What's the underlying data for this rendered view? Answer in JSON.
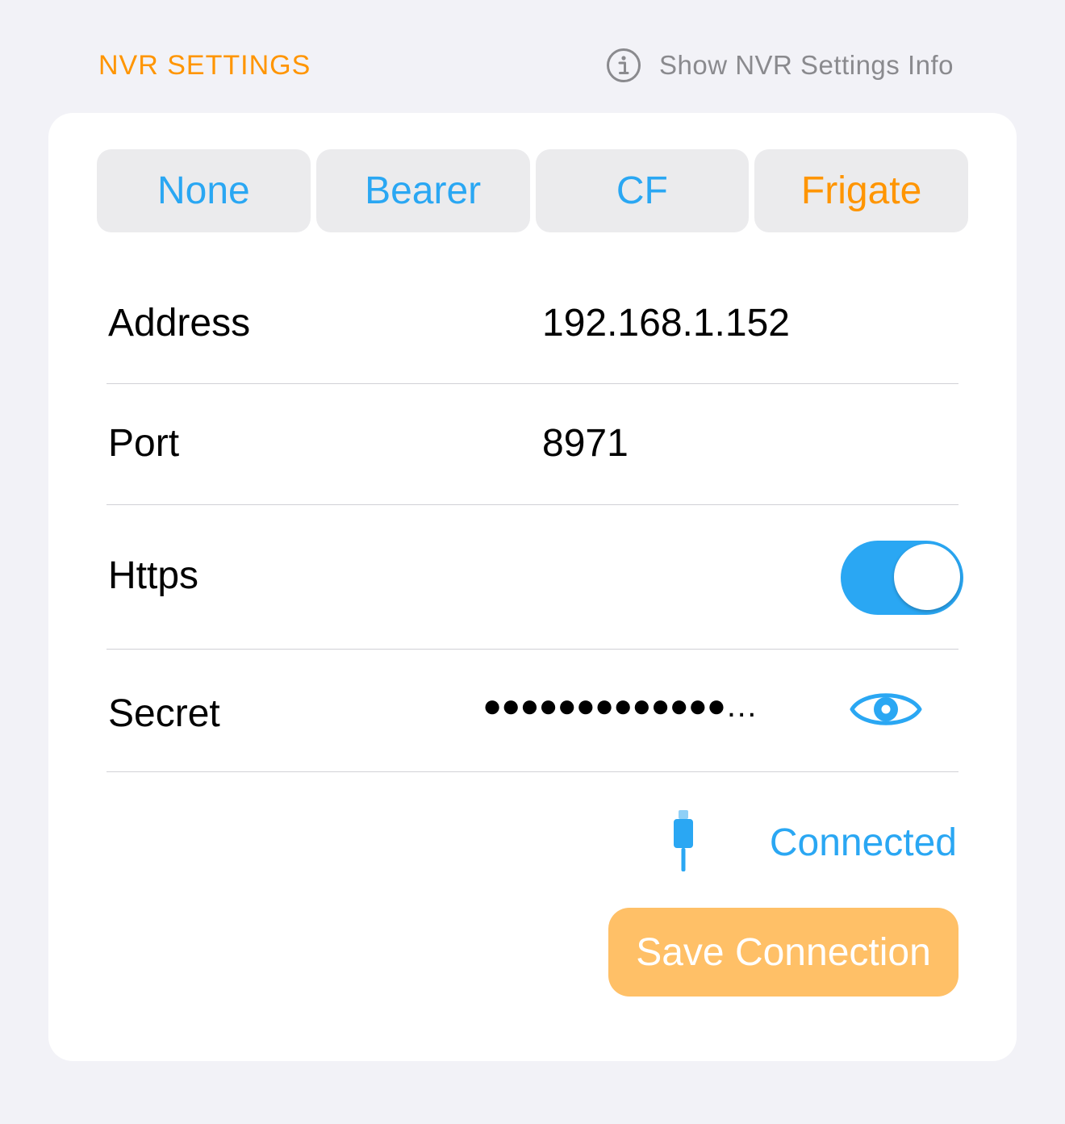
{
  "header": {
    "title": "NVR SETTINGS",
    "info_label": "Show NVR Settings Info",
    "info_icon": "info-circle-icon"
  },
  "auth_type": {
    "options": [
      "None",
      "Bearer",
      "CF",
      "Frigate"
    ],
    "selected": "Frigate"
  },
  "fields": {
    "address": {
      "label": "Address",
      "value": "192.168.1.152"
    },
    "port": {
      "label": "Port",
      "value": "8971"
    },
    "https": {
      "label": "Https",
      "enabled": true
    },
    "secret": {
      "label": "Secret",
      "masked_value": "●●●●●●●●●●●●●…",
      "reveal_icon": "eye-icon"
    }
  },
  "status": {
    "icon": "plug-icon",
    "label": "Connected"
  },
  "actions": {
    "save_label": "Save Connection"
  },
  "colors": {
    "accent_orange": "#ff9500",
    "accent_blue": "#2aa7f3",
    "save_button_bg": "#ffc067",
    "background": "#f2f2f7"
  }
}
